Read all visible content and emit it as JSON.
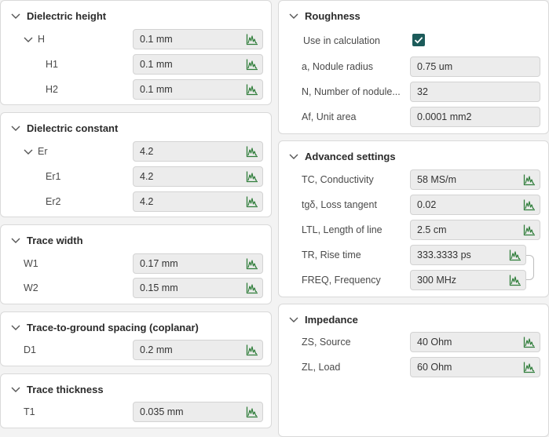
{
  "left": {
    "dielectric_height": {
      "title": "Dielectric height",
      "rows": [
        {
          "label": "H",
          "value": "0.1 mm"
        },
        {
          "label": "H1",
          "value": "0.1 mm"
        },
        {
          "label": "H2",
          "value": "0.1 mm"
        }
      ]
    },
    "dielectric_constant": {
      "title": "Dielectric constant",
      "rows": [
        {
          "label": "Er",
          "value": "4.2"
        },
        {
          "label": "Er1",
          "value": "4.2"
        },
        {
          "label": "Er2",
          "value": "4.2"
        }
      ]
    },
    "trace_width": {
      "title": "Trace width",
      "rows": [
        {
          "label": "W1",
          "value": "0.17 mm"
        },
        {
          "label": "W2",
          "value": "0.15 mm"
        }
      ]
    },
    "trace_ground_spacing": {
      "title": "Trace-to-ground spacing (coplanar)",
      "rows": [
        {
          "label": "D1",
          "value": "0.2 mm"
        }
      ]
    },
    "trace_thickness": {
      "title": "Trace thickness",
      "rows": [
        {
          "label": "T1",
          "value": "0.035 mm"
        }
      ]
    }
  },
  "right": {
    "roughness": {
      "title": "Roughness",
      "use_in_calculation": {
        "label": "Use in calculation",
        "checked": true
      },
      "rows": [
        {
          "label": "a, Nodule radius",
          "value": "0.75 um"
        },
        {
          "label": "N, Number of nodule...",
          "value": "32"
        },
        {
          "label": "Af, Unit area",
          "value": "0.0001 mm2"
        }
      ]
    },
    "advanced": {
      "title": "Advanced settings",
      "rows": [
        {
          "label": "TC, Conductivity",
          "value": "58 MS/m"
        },
        {
          "label": "tgδ, Loss tangent",
          "value": "0.02"
        },
        {
          "label": "LTL, Length of line",
          "value": "2.5 cm"
        },
        {
          "label": "TR, Rise time",
          "value": "333.3333 ps"
        },
        {
          "label": "FREQ, Frequency",
          "value": "300 MHz"
        }
      ]
    },
    "impedance": {
      "title": "Impedance",
      "rows": [
        {
          "label": "ZS, Source",
          "value": "40 Ohm"
        },
        {
          "label": "ZL, Load",
          "value": "60 Ohm"
        }
      ]
    }
  },
  "icons": {
    "chevron": "chevron-down-icon",
    "graph": "graph-icon",
    "checkmark": "checkmark-icon"
  },
  "colors": {
    "checkbox": "#1c5b5a",
    "icon_green": "#2f7d3a",
    "field_bg": "#ececec",
    "panel_bg": "#ffffff",
    "page_bg": "#f3f3f3"
  }
}
